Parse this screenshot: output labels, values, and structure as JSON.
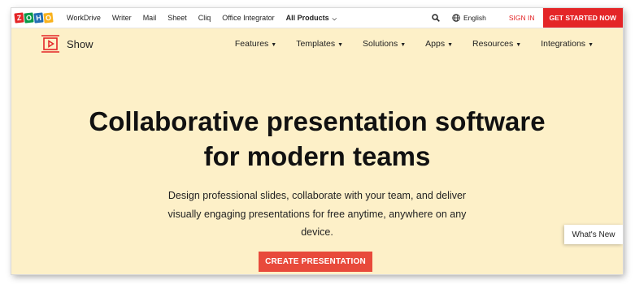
{
  "topbar": {
    "logo_letters": [
      "Z",
      "O",
      "H",
      "O"
    ],
    "logo_colors": [
      "#e42527",
      "#089949",
      "#226db4",
      "#f9b21d"
    ],
    "links": [
      "WorkDrive",
      "Writer",
      "Mail",
      "Sheet",
      "Cliq",
      "Office Integrator"
    ],
    "all_products": "All Products",
    "language": "English",
    "sign_in": "SIGN IN",
    "get_started": "GET STARTED NOW"
  },
  "header": {
    "product_name": "Show",
    "nav": [
      "Features",
      "Templates",
      "Solutions",
      "Apps",
      "Resources",
      "Integrations"
    ]
  },
  "hero": {
    "title_line1": "Collaborative presentation software",
    "title_line2": "for modern teams",
    "subtitle": "Design professional slides, collaborate with your team, and deliver visually engaging presentations for free anytime, anywhere on any device.",
    "cta": "CREATE PRESENTATION"
  },
  "widget": {
    "whats_new": "What's New"
  },
  "colors": {
    "background": "#fdf0c8",
    "brand_red": "#e42527",
    "cta_red": "#e84a3b"
  }
}
